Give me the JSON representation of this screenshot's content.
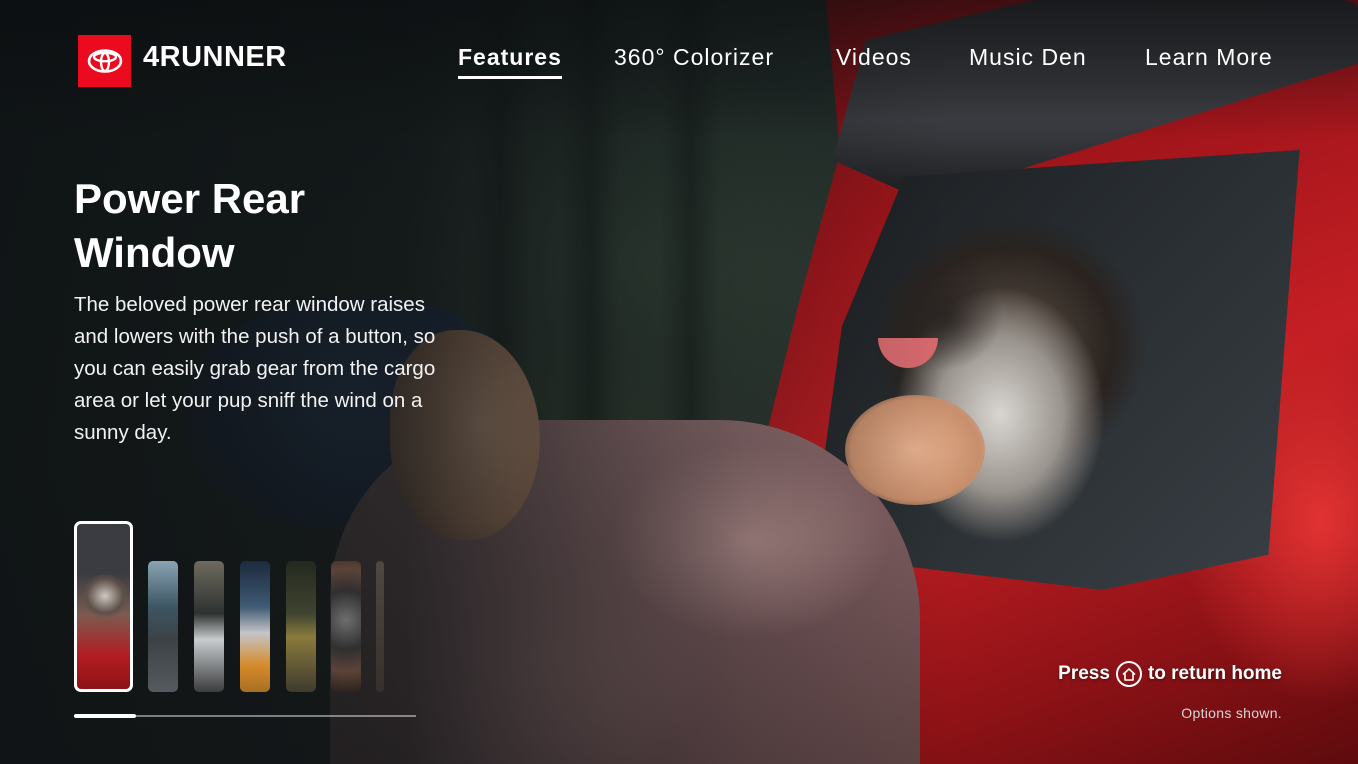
{
  "brand": {
    "name": "4RUNNER",
    "logo_icon": "toyota-logo-icon",
    "logo_color": "#eb0a1e"
  },
  "nav": {
    "items": [
      {
        "label": "Features",
        "active": true
      },
      {
        "label": "360° Colorizer",
        "active": false
      },
      {
        "label": "Videos",
        "active": false
      },
      {
        "label": "Music Den",
        "active": false
      },
      {
        "label": "Learn More",
        "active": false
      }
    ]
  },
  "feature": {
    "title_line1": "Power Rear",
    "title_line2": "Window",
    "description": "The beloved power rear window raises and lowers with the push of a button, so you can easily grab gear from the cargo area or let your pup sniff the wind on a sunny day."
  },
  "carousel": {
    "selected_index": 0,
    "thumbnail_count": 6,
    "progress": 0.18
  },
  "footer": {
    "hint_prefix": "Press",
    "hint_icon": "home-icon",
    "hint_suffix": "to return home",
    "disclaimer": "Options shown."
  }
}
